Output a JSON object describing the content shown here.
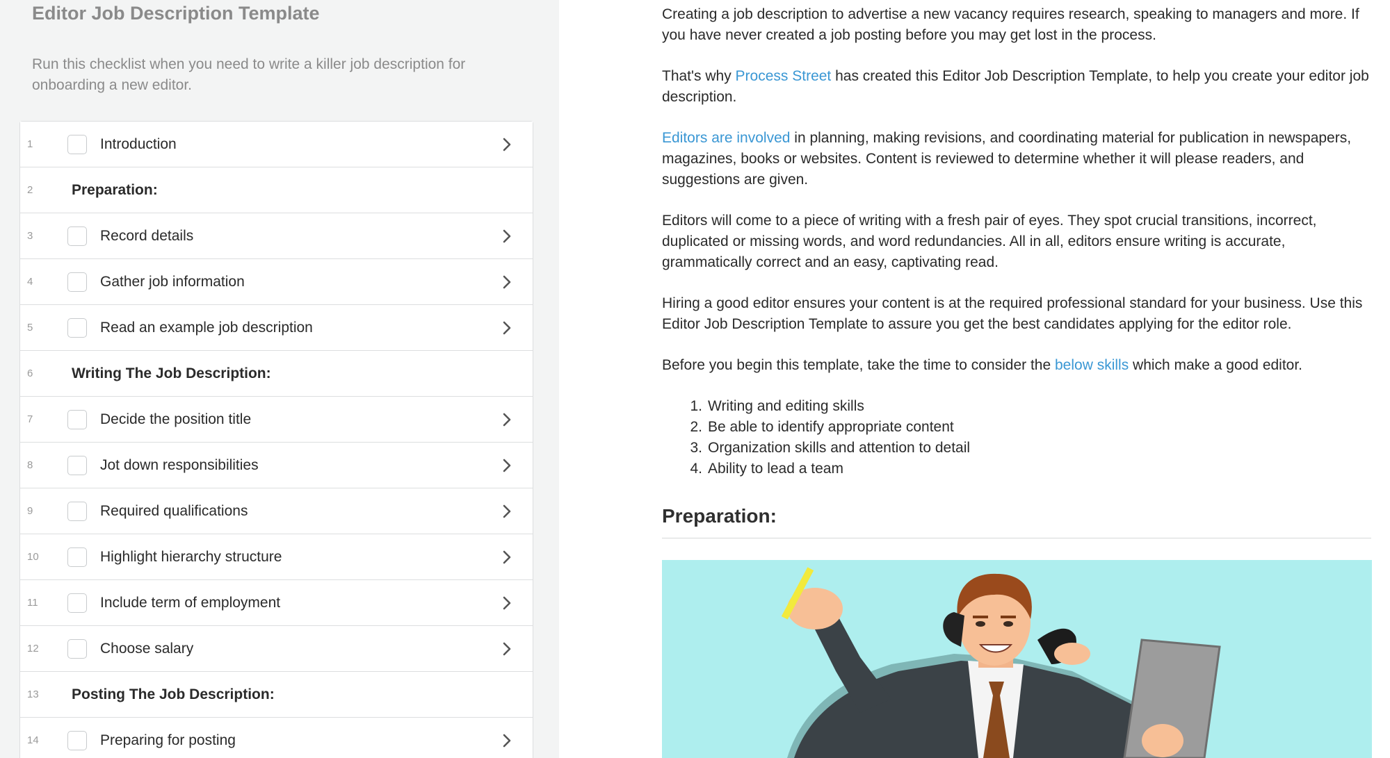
{
  "template": {
    "title": "Editor Job Description Template",
    "description": "Run this checklist when you need to write a killer job description for onboarding a new editor."
  },
  "tasks": [
    {
      "num": "1",
      "label": "Introduction",
      "type": "task"
    },
    {
      "num": "2",
      "label": "Preparation:",
      "type": "heading"
    },
    {
      "num": "3",
      "label": "Record details",
      "type": "task"
    },
    {
      "num": "4",
      "label": "Gather job information",
      "type": "task"
    },
    {
      "num": "5",
      "label": "Read an example job description",
      "type": "task"
    },
    {
      "num": "6",
      "label": "Writing The Job Description:",
      "type": "heading"
    },
    {
      "num": "7",
      "label": "Decide the position title",
      "type": "task"
    },
    {
      "num": "8",
      "label": "Jot down responsibilities",
      "type": "task"
    },
    {
      "num": "9",
      "label": "Required qualifications",
      "type": "task"
    },
    {
      "num": "10",
      "label": "Highlight hierarchy structure",
      "type": "task"
    },
    {
      "num": "11",
      "label": "Include term of employment",
      "type": "task"
    },
    {
      "num": "12",
      "label": "Choose salary",
      "type": "task"
    },
    {
      "num": "13",
      "label": "Posting The Job Description:",
      "type": "heading"
    },
    {
      "num": "14",
      "label": "Preparing for posting",
      "type": "task"
    }
  ],
  "content": {
    "para1": "Creating a job description to advertise a new vacancy requires research, speaking to managers and more. If you have never created a job posting before you may get lost in the process.",
    "para2_before": "That's why ",
    "para2_link": "Process Street",
    "para2_after": " has created this Editor Job Description Template, to help you create your editor job description.",
    "para3_link": "Editors are involved",
    "para3_after": " in planning, making revisions, and coordinating material for publication in newspapers, magazines, books or websites. Content is reviewed to determine whether it will please readers, and suggestions are given.",
    "para4": "Editors will come to a piece of writing with a fresh pair of eyes. They spot crucial transitions, incorrect, duplicated or missing words, and word redundancies. All in all, editors ensure writing is accurate, grammatically correct and an easy, captivating read.",
    "para5": "Hiring a good editor ensures your content is at the required professional standard for your business. Use this Editor Job Description Template to assure you get the best candidates applying for the editor role.",
    "para6_before": "Before you begin this template, take the time to consider the ",
    "para6_link": "below skills",
    "para6_after": " which make a good editor.",
    "skills": [
      {
        "num": "1.",
        "text": "Writing and editing skills"
      },
      {
        "num": "2.",
        "text": "Be able to identify appropriate content"
      },
      {
        "num": "3.",
        "text": "Organization skills and attention to detail"
      },
      {
        "num": "4.",
        "text": "Ability to lead a team"
      }
    ],
    "prep_heading": "Preparation:"
  },
  "colors": {
    "link": "#3a97d4",
    "panel_bg": "#f3f4f4",
    "illustration_bg": "#aeeeee"
  },
  "icons": {
    "task_arrow": "chevron-right-icon",
    "task_checkbox": "checkbox-icon"
  }
}
